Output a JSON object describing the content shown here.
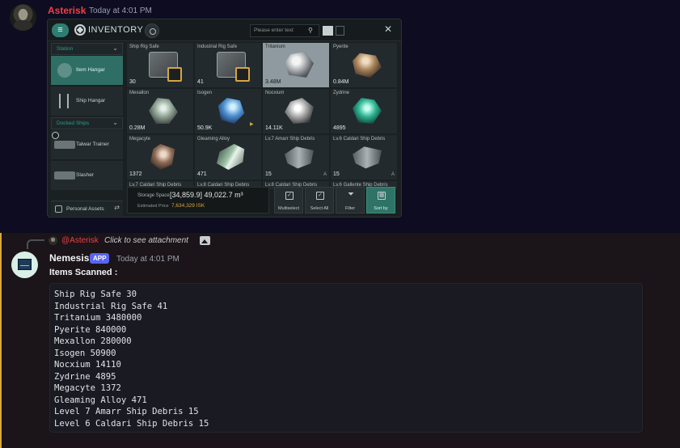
{
  "message1": {
    "author": "Asterisk",
    "timestamp": "Today at 4:01 PM",
    "colors": {
      "author": "#f23f43"
    }
  },
  "inventory": {
    "title": "INVENTORY",
    "search_placeholder": "Please enter text",
    "sidebar": {
      "station_header": "Station",
      "items": [
        {
          "label": "Item Hangar",
          "icon": "item-hangar-icon",
          "active": true
        },
        {
          "label": "Ship Hangar",
          "icon": "ship-hangar-icon",
          "active": false
        }
      ],
      "docked_header": "Docked Ships",
      "ships": [
        {
          "label": "Talwar Trainer"
        },
        {
          "label": "Slasher"
        }
      ],
      "personal_assets": "Personal Assets"
    },
    "tiles": [
      {
        "name": "Ship Rig Safe",
        "qty": "30"
      },
      {
        "name": "Industrial Rig Safe",
        "qty": "41"
      },
      {
        "name": "Tritanium",
        "qty": "3.48M"
      },
      {
        "name": "Pyerite",
        "qty": "0.84M"
      },
      {
        "name": "Mexallon",
        "qty": "0.28M"
      },
      {
        "name": "Isogen",
        "qty": "50.9K"
      },
      {
        "name": "Nocxium",
        "qty": "14.11K"
      },
      {
        "name": "Zydrine",
        "qty": "4895"
      },
      {
        "name": "Megacyte",
        "qty": "1372"
      },
      {
        "name": "Gleaming Alloy",
        "qty": "471"
      },
      {
        "name": "Lv.7 Amarr Ship Debris",
        "qty": "15",
        "badge": "A"
      },
      {
        "name": "Lv.6 Caldari Ship Debris",
        "qty": "15",
        "badge": "A"
      }
    ],
    "partial_row": [
      "Lv.7 Caldari Ship Debris",
      "Lv.8 Caldari Ship Debris",
      "Lv.8 Caldari Ship Debris",
      "Lv.6 Gallente Ship Debris"
    ],
    "storage": {
      "label": "Storage Space",
      "value": "[34,859.9] 49,022.7 m³",
      "price_label": "Estimated Price",
      "price_value": "7,634,329 ISK"
    },
    "actions": [
      {
        "label": "Multiselect"
      },
      {
        "label": "Select All"
      },
      {
        "label": "Filter"
      },
      {
        "label": "Sort by"
      }
    ],
    "colors": {
      "accent": "#2f7d72",
      "gold": "#d6a640"
    }
  },
  "message2": {
    "reply": {
      "mention": "@Asterisk",
      "text": "Click to see attachment"
    },
    "author": "Nemesis",
    "tag": "APP",
    "timestamp": "Today at 4:01 PM",
    "heading": "Items Scanned :",
    "lines": [
      "Ship Rig Safe 30",
      "Industrial Rig Safe 41",
      "Tritanium 3480000",
      "Pyerite 840000",
      "Mexallon 280000",
      "Isogen 50900",
      "Nocxium 14110",
      "Zydrine 4895",
      "Megacyte 1372",
      "Gleaming Alloy 471",
      "Level 7 Amarr Ship Debris 15",
      "Level 6 Caldari Ship Debris 15"
    ],
    "colors": {
      "tag": "#5865f2",
      "highlight_bar": "#d9a73a"
    }
  }
}
